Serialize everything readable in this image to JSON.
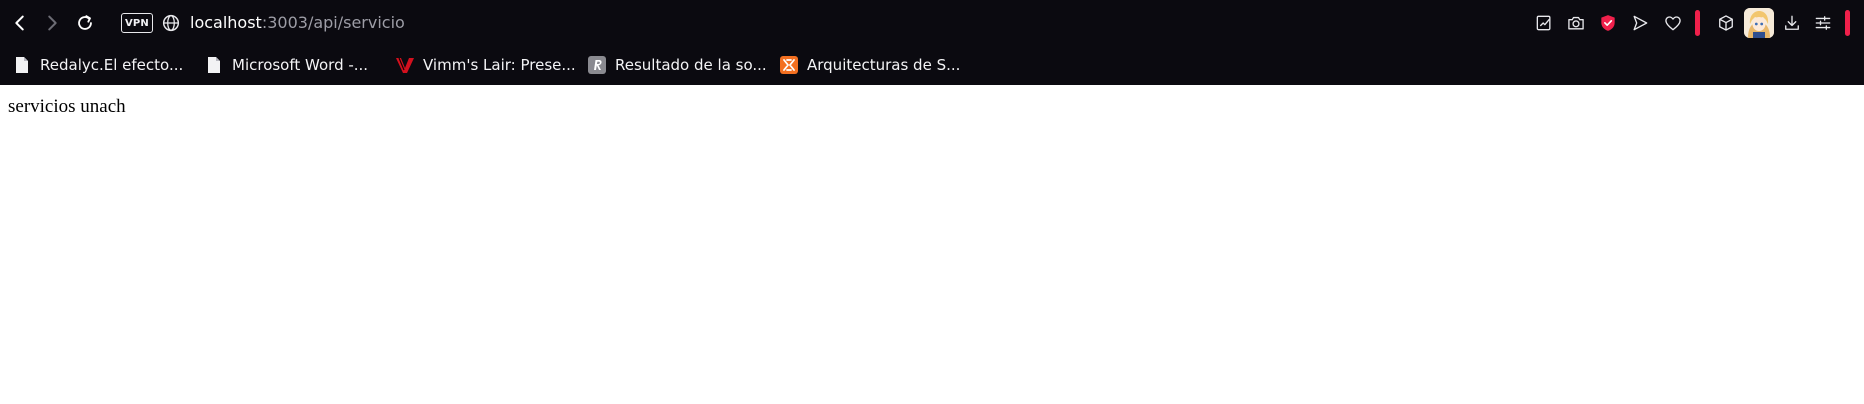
{
  "toolbar": {
    "vpn_label": "VPN",
    "address_host": "localhost",
    "address_path": ":3003/api/servicio",
    "icons": {
      "back": "back-arrow-icon",
      "forward": "forward-arrow-icon",
      "reload": "reload-icon",
      "site_info": "globe-icon",
      "edit_page": "edit-page-icon",
      "snapshot": "camera-icon",
      "ad_blocker": "shield-check-icon",
      "send": "send-icon",
      "favorites": "heart-icon",
      "extensions": "cube-icon",
      "profile": "avatar",
      "downloads": "download-icon",
      "easy_setup": "settings-sliders-icon"
    },
    "accent_color": "#f0204b"
  },
  "bookmarks": [
    {
      "label": "Redalyc.El efecto...",
      "icon": "document-icon"
    },
    {
      "label": "Microsoft Word -...",
      "icon": "document-icon"
    },
    {
      "label": "Vimm's Lair: Prese...",
      "icon": "vimm-logo-icon"
    },
    {
      "label": "Resultado de la so...",
      "icon": "r-logo-icon"
    },
    {
      "label": "Arquitecturas de S...",
      "icon": "xampp-logo-icon"
    }
  ],
  "page": {
    "body_text": "servicios unach"
  }
}
